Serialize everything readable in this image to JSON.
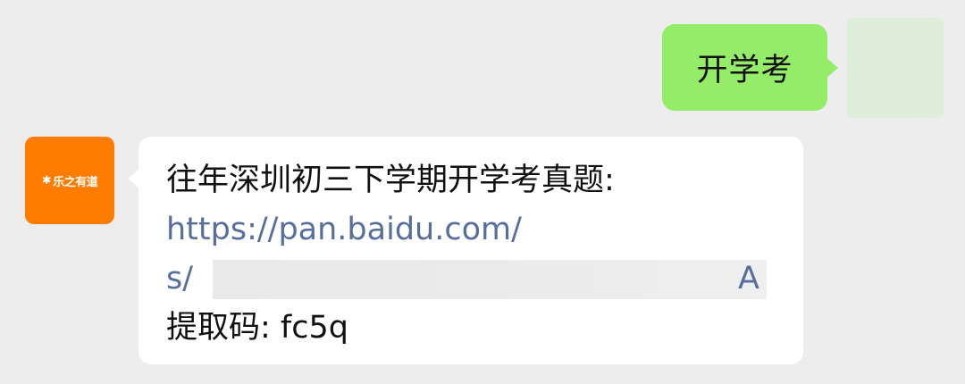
{
  "outgoing": {
    "text": "开学考"
  },
  "incoming": {
    "avatar_text": "乐之有道",
    "line1": "往年深圳初三下学期开学考真题:",
    "link_line1": "https://pan.baidu.com/",
    "link_prefix": "s/",
    "link_suffix": "A",
    "line_code": "提取码: fc5q"
  },
  "colors": {
    "background": "#ededed",
    "outgoing_bubble": "#95ec69",
    "incoming_bubble": "#ffffff",
    "link": "#586e9c",
    "bot_avatar": "#ff7c00"
  }
}
